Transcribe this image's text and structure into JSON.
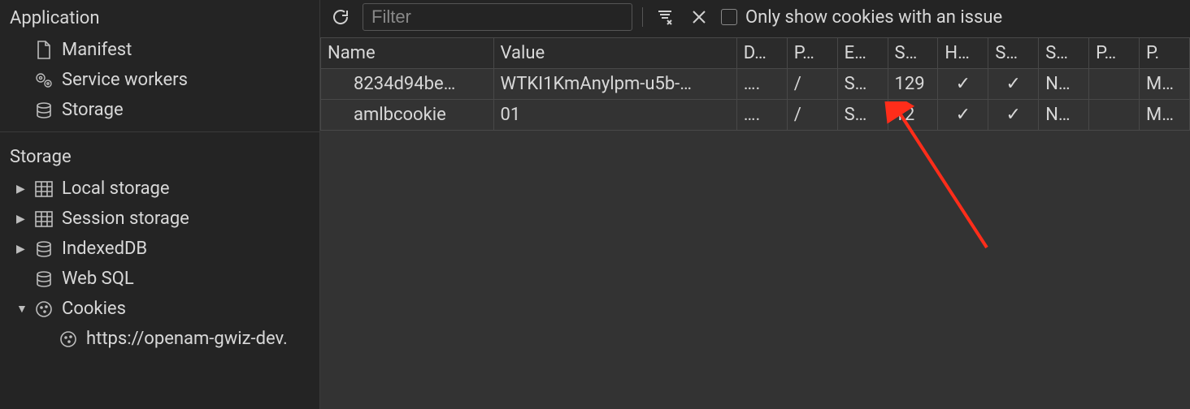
{
  "sidebar": {
    "groups": [
      {
        "title": "Application",
        "items": [
          {
            "label": "Manifest",
            "icon": "manifest"
          },
          {
            "label": "Service workers",
            "icon": "gears"
          },
          {
            "label": "Storage",
            "icon": "db"
          }
        ]
      },
      {
        "title": "Storage",
        "items": [
          {
            "label": "Local storage",
            "icon": "grid",
            "expandable": true
          },
          {
            "label": "Session storage",
            "icon": "grid",
            "expandable": true
          },
          {
            "label": "IndexedDB",
            "icon": "db",
            "expandable": true
          },
          {
            "label": "Web SQL",
            "icon": "db"
          },
          {
            "label": "Cookies",
            "icon": "cookie",
            "expandable": true,
            "expanded": true,
            "children": [
              {
                "label": "https://openam-gwiz-dev.",
                "icon": "cookie"
              }
            ]
          }
        ]
      }
    ]
  },
  "toolbar": {
    "filter_placeholder": "Filter",
    "only_issues_label": "Only show cookies with an issue"
  },
  "table": {
    "columns": [
      "Name",
      "Value",
      "D…",
      "P…",
      "E…",
      "S…",
      "H…",
      "S…",
      "S…",
      "P…",
      "P."
    ],
    "rows": [
      {
        "name": "8234d94be…",
        "value": "WTKI1KmAnylpm-u5b-…",
        "domain": "….",
        "path": "/",
        "expires": "S…",
        "size": "129",
        "httponly": "✓",
        "secure": "✓",
        "samesite": "N…",
        "priority": "",
        "p2": "M…"
      },
      {
        "name": "amlbcookie",
        "value": "01",
        "domain": "….",
        "path": "/",
        "expires": "S…",
        "size": "12",
        "httponly": "✓",
        "secure": "✓",
        "samesite": "N…",
        "priority": "",
        "p2": "M…"
      }
    ]
  }
}
